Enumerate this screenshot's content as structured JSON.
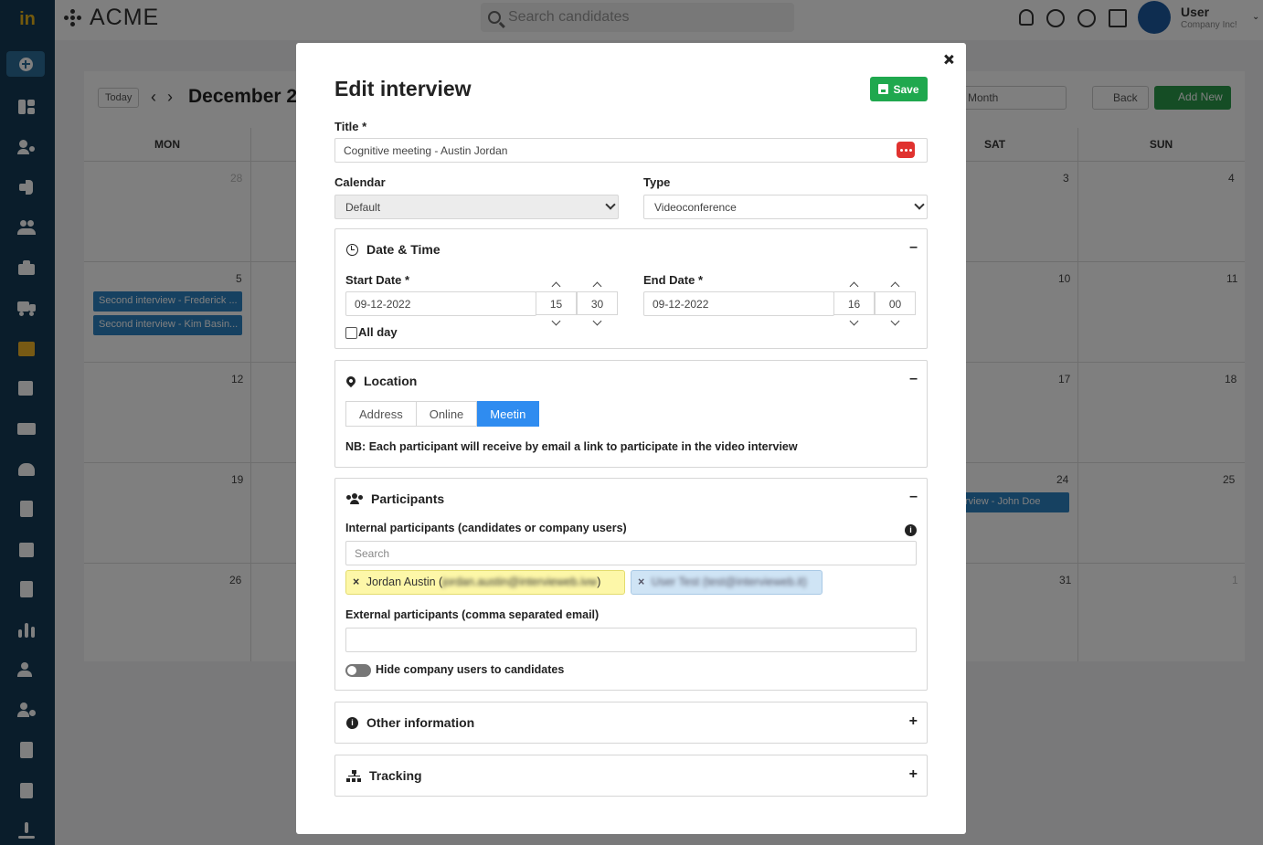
{
  "app": {
    "brand": "ACME",
    "search_placeholder": "Search candidates",
    "user_name": "User",
    "user_company": "Company Inc!"
  },
  "calendar": {
    "today_label": "Today",
    "title": "December 2",
    "view": "Month",
    "back_label": "Back",
    "add_new_label": "Add New",
    "days": [
      "MON",
      "SAT",
      "SUN"
    ],
    "dates": {
      "r1_mon": "28",
      "r1_sat": "3",
      "r1_sun": "4",
      "r2_mon": "5",
      "r2_sat": "10",
      "r2_sun": "11",
      "r3_mon": "12",
      "r3_sat": "17",
      "r3_sun": "18",
      "r4_mon": "19",
      "r4_sat": "24",
      "r4_sun": "25",
      "r5_mon": "26",
      "r5_sat": "31",
      "r5_sun": "1"
    },
    "events": [
      "Second interview - Frederick ...",
      "Second interview - Kim Basin...",
      "rview - John Doe"
    ]
  },
  "modal": {
    "title": "Edit interview",
    "save_label": "Save",
    "title_label": "Title *",
    "title_value": "Cognitive meeting - Austin Jordan",
    "calendar_label": "Calendar",
    "calendar_value": "Default",
    "type_label": "Type",
    "type_value": "Videoconference",
    "datetime": {
      "heading": "Date & Time",
      "start_label": "Start Date *",
      "start_date": "09-12-2022",
      "start_hour": "15",
      "start_min": "30",
      "end_label": "End Date *",
      "end_date": "09-12-2022",
      "end_hour": "16",
      "end_min": "00",
      "all_day_label": "All day"
    },
    "location": {
      "heading": "Location",
      "tabs": [
        "Address",
        "Online",
        "Meetin"
      ],
      "note": "NB: Each participant will receive by email a link to participate in the video interview"
    },
    "participants": {
      "heading": "Participants",
      "internal_label": "Internal participants (candidates or company users)",
      "search_placeholder": "Search",
      "tag1_name": "Jordan Austin (",
      "tag1_email": "jordan.austin@intervieweb.ivw",
      "tag1_close": ")",
      "tag2_text": "User Test (test@intervieweb.it)",
      "external_label": "External participants (comma separated email)",
      "hide_label": "Hide company users to candidates"
    },
    "other_heading": "Other information",
    "tracking_heading": "Tracking"
  }
}
